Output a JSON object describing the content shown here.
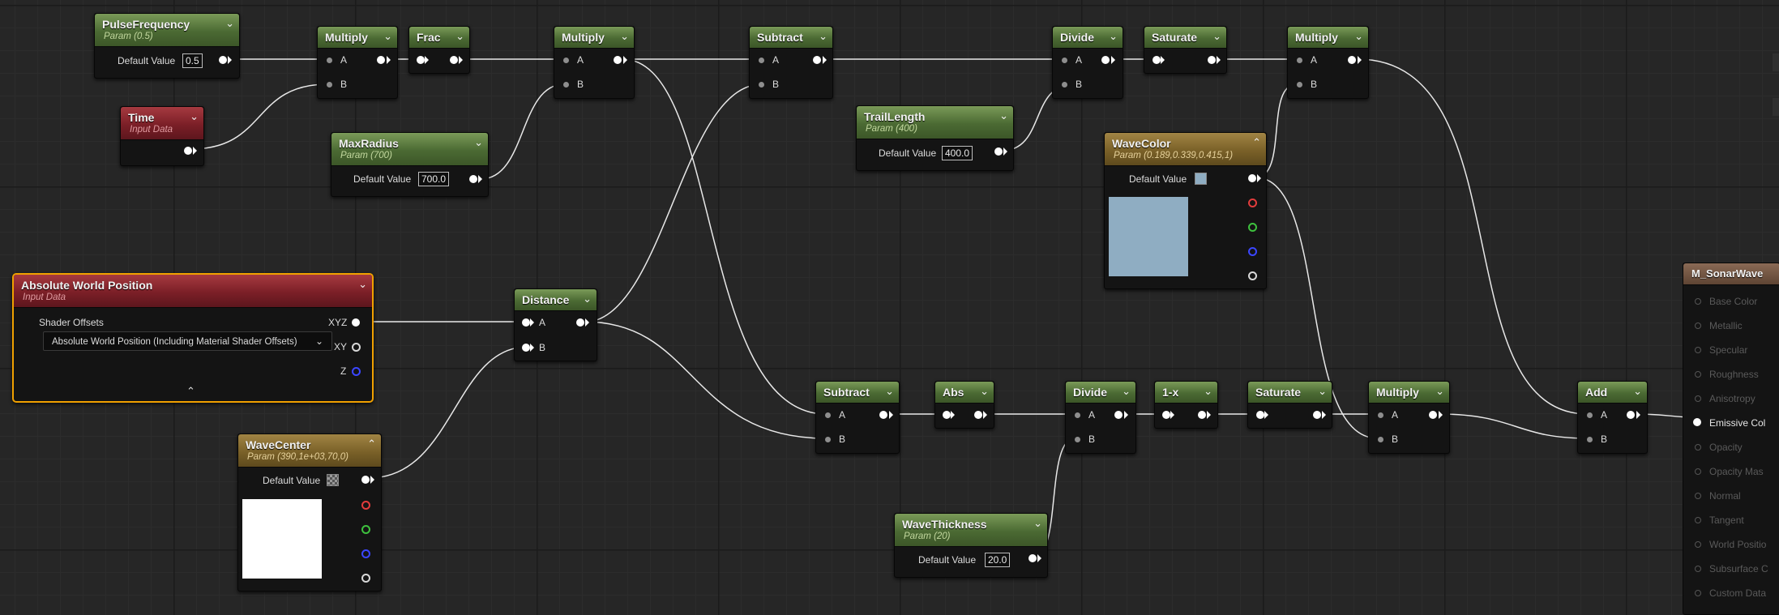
{
  "colors": {
    "param_header": "#5a7a3f",
    "input_header": "#7b1f27",
    "vector_param_header": "#7a6128",
    "selection": "#f0a000",
    "wire": "#e8e8e8",
    "canvas": "#262626"
  },
  "nodes": {
    "pulse_frequency": {
      "title": "PulseFrequency",
      "subtitle": "Param (0.5)",
      "label": "Default Value",
      "value": "0.5"
    },
    "time": {
      "title": "Time",
      "subtitle": "Input Data"
    },
    "multiply1": {
      "title": "Multiply",
      "pin_a": "A",
      "pin_b": "B"
    },
    "frac": {
      "title": "Frac"
    },
    "max_radius": {
      "title": "MaxRadius",
      "subtitle": "Param (700)",
      "label": "Default Value",
      "value": "700.0"
    },
    "multiply2": {
      "title": "Multiply",
      "pin_a": "A",
      "pin_b": "B"
    },
    "subtract1": {
      "title": "Subtract",
      "pin_a": "A",
      "pin_b": "B"
    },
    "trail_length": {
      "title": "TrailLength",
      "subtitle": "Param (400)",
      "label": "Default Value",
      "value": "400.0"
    },
    "divide1": {
      "title": "Divide",
      "pin_a": "A",
      "pin_b": "B"
    },
    "saturate1": {
      "title": "Saturate"
    },
    "wave_color": {
      "title": "WaveColor",
      "subtitle": "Param (0.189,0.339,0.415,1)",
      "label": "Default Value",
      "color": "#8fadc2"
    },
    "multiply3": {
      "title": "Multiply",
      "pin_a": "A",
      "pin_b": "B"
    },
    "absolute_world_position": {
      "title": "Absolute World Position",
      "subtitle": "Input Data",
      "option_label": "Shader Offsets",
      "option_value": "Absolute World Position (Including Material Shader Offsets)",
      "out_xyz": "XYZ",
      "out_xy": "XY",
      "out_z": "Z"
    },
    "distance": {
      "title": "Distance",
      "pin_a": "A",
      "pin_b": "B"
    },
    "wave_center": {
      "title": "WaveCenter",
      "subtitle": "Param (390,1e+03,70,0)",
      "label": "Default Value",
      "color": "#ffffff"
    },
    "subtract2": {
      "title": "Subtract",
      "pin_a": "A",
      "pin_b": "B"
    },
    "abs": {
      "title": "Abs"
    },
    "divide2": {
      "title": "Divide",
      "pin_a": "A",
      "pin_b": "B"
    },
    "one_minus": {
      "title": "1-x"
    },
    "saturate2": {
      "title": "Saturate"
    },
    "multiply4": {
      "title": "Multiply",
      "pin_a": "A",
      "pin_b": "B"
    },
    "add": {
      "title": "Add",
      "pin_a": "A",
      "pin_b": "B"
    },
    "wave_thickness": {
      "title": "WaveThickness",
      "subtitle": "Param (20)",
      "label": "Default Value",
      "value": "20.0"
    }
  },
  "material_output": {
    "title": "M_SonarWave",
    "inputs": [
      "Base Color",
      "Metallic",
      "Specular",
      "Roughness",
      "Anisotropy",
      "Emissive Col",
      "Opacity",
      "Opacity Mas",
      "Normal",
      "Tangent",
      "World Positio",
      "Subsurface C",
      "Custom Data"
    ],
    "active_input": "Emissive Col"
  }
}
